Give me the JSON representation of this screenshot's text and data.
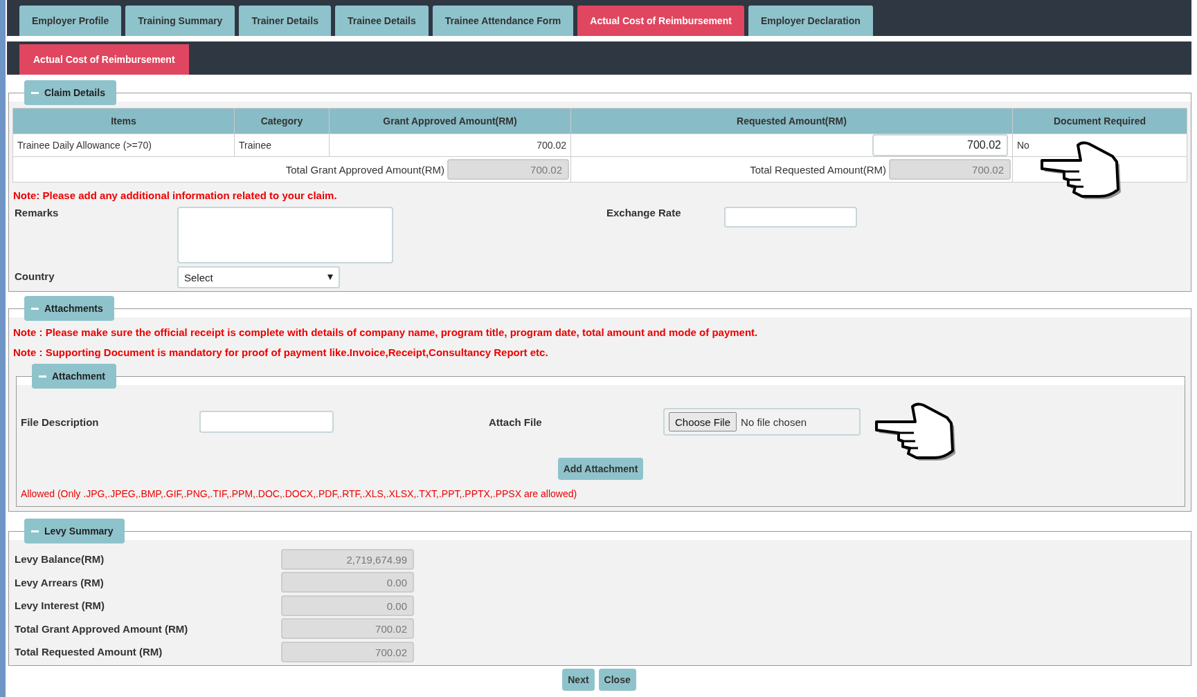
{
  "tabs": [
    {
      "label": "Employer Profile",
      "selected": false
    },
    {
      "label": "Training Summary",
      "selected": false
    },
    {
      "label": "Trainer Details",
      "selected": false
    },
    {
      "label": "Trainee Details",
      "selected": false
    },
    {
      "label": "Trainee Attendance Form",
      "selected": false
    },
    {
      "label": "Actual Cost of Reimbursement",
      "selected": true
    },
    {
      "label": "Employer Declaration",
      "selected": false
    }
  ],
  "section_tab": {
    "label": "Actual Cost of Reimbursement"
  },
  "claim_details": {
    "legend": "Claim Details",
    "columns": [
      "Items",
      "Category",
      "Grant Approved Amount(RM)",
      "Requested Amount(RM)",
      "Document Required"
    ],
    "rows": [
      {
        "item": "Trainee Daily Allowance (>=70)",
        "category": "Trainee",
        "grant_approved": "700.02",
        "requested": "700.02",
        "document_required": "No"
      }
    ],
    "totals": {
      "grant_label": "Total Grant Approved Amount(RM)",
      "grant_value": "700.02",
      "requested_label": "Total Requested Amount(RM)",
      "requested_value": "700.02"
    },
    "note": "Note: Please add any additional information related to your claim.",
    "remarks_label": "Remarks",
    "exchange_rate_label": "Exchange Rate",
    "country_label": "Country",
    "country_value": "Select"
  },
  "attachments": {
    "legend": "Attachments",
    "notes": [
      "Note : Please make sure the official receipt is complete with details of company name, program title, program date, total amount and mode of payment.",
      "Note : Supporting Document is mandatory for proof of payment like.Invoice,Receipt,Consultancy Report etc."
    ],
    "attachment": {
      "legend": "Attachment",
      "file_description_label": "File Description",
      "attach_file_label": "Attach File",
      "choose_file": "Choose File",
      "no_file": "No file chosen",
      "add_button": "Add Attachment",
      "allowed": "Allowed (Only .JPG,.JPEG,.BMP,.GIF,.PNG,.TIF,.PPM,.DOC,.DOCX,.PDF,.RTF,.XLS,.XLSX,.TXT,.PPT,.PPTX,.PPSX are allowed)"
    }
  },
  "levy_summary": {
    "legend": "Levy Summary",
    "rows": [
      {
        "label": "Levy Balance(RM)",
        "value": "2,719,674.99"
      },
      {
        "label": "Levy Arrears (RM)",
        "value": "0.00"
      },
      {
        "label": "Levy Interest (RM)",
        "value": "0.00"
      },
      {
        "label": "Total Grant Approved Amount (RM)",
        "value": "700.02"
      },
      {
        "label": "Total Requested Amount (RM)",
        "value": "700.02"
      }
    ]
  },
  "buttons": [
    "Next",
    "Close"
  ]
}
